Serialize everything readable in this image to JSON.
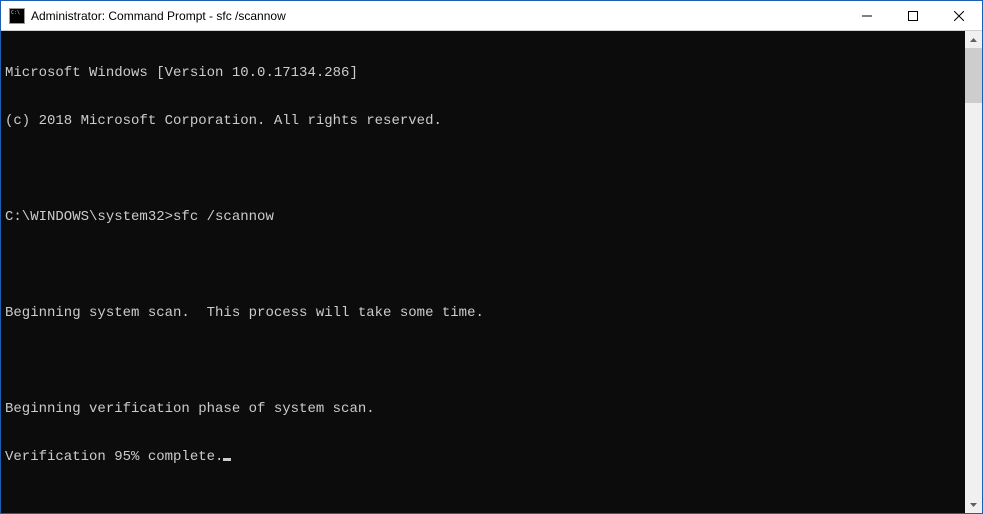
{
  "window": {
    "title": "Administrator: Command Prompt - sfc  /scannow"
  },
  "console": {
    "lines": [
      "Microsoft Windows [Version 10.0.17134.286]",
      "(c) 2018 Microsoft Corporation. All rights reserved.",
      "",
      "C:\\WINDOWS\\system32>sfc /scannow",
      "",
      "Beginning system scan.  This process will take some time.",
      "",
      "Beginning verification phase of system scan.",
      "Verification 95% complete."
    ]
  }
}
